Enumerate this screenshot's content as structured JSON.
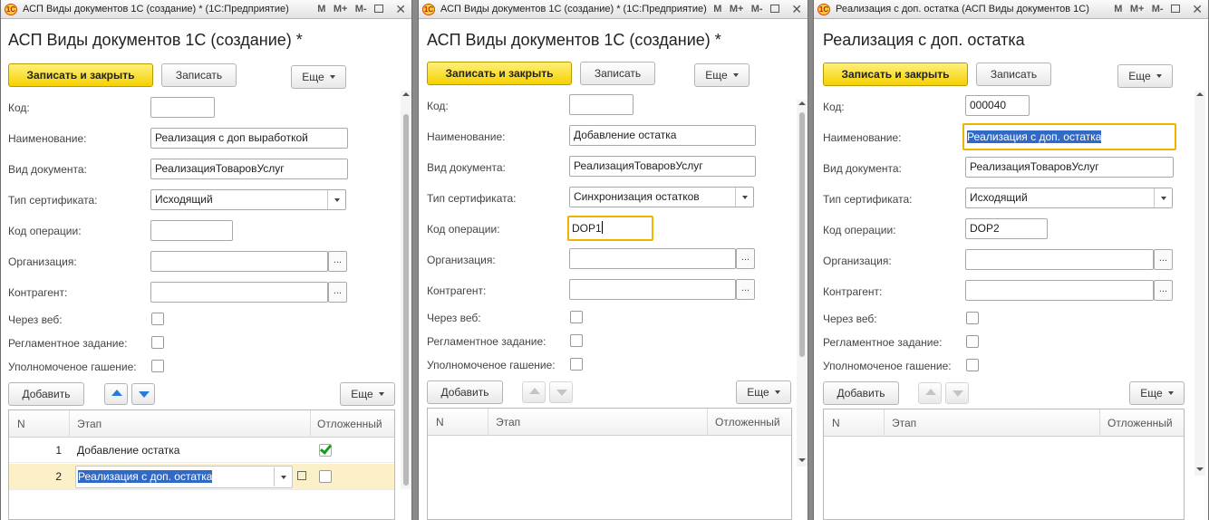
{
  "labels": {
    "code": "Код:",
    "name": "Наименование:",
    "doc_type": "Вид документа:",
    "cert_type": "Тип сертификата:",
    "op_code": "Код операции:",
    "org": "Организация:",
    "counterparty": "Контрагент:",
    "via_web": "Через веб:",
    "scheduled": "Регламентное задание:",
    "auth_payoff": "Уполномоченое гашение:"
  },
  "buttons": {
    "save_close": "Записать и закрыть",
    "save": "Записать",
    "more": "Еще",
    "add": "Добавить",
    "dots": "..."
  },
  "table_headers": {
    "n": "N",
    "stage": "Этап",
    "deferred": "Отложенный"
  },
  "titlebar_buttons": {
    "m": "M",
    "mplus": "M+",
    "mminus": "M-"
  },
  "logo": "1С",
  "windows": [
    {
      "window_title": "АСП Виды документов 1С (создание) * (1С:Предприятие)",
      "doc_title": "АСП Виды документов 1С (создание) *",
      "fields": {
        "code": "",
        "name": "Реализация с доп выработкой",
        "doc_type": "РеализацияТоваровУслуг",
        "cert_type": "Исходящий",
        "op_code": "",
        "org": "",
        "counterparty": ""
      },
      "rows": [
        {
          "n": "1",
          "stage": "Добавление остатка",
          "deferred": true
        },
        {
          "n": "2",
          "stage": "Реализация с доп. остатка",
          "deferred": false
        }
      ]
    },
    {
      "window_title": "АСП Виды документов 1С (создание) * (1С:Предприятие)",
      "doc_title": "АСП Виды документов 1С (создание) *",
      "fields": {
        "code": "",
        "name": "Добавление остатка",
        "doc_type": "РеализацияТоваровУслуг",
        "cert_type": "Синхронизация остатков",
        "op_code": "DOP1",
        "org": "",
        "counterparty": ""
      },
      "rows": []
    },
    {
      "window_title": "Реализация с доп. остатка (АСП Виды документов 1С)",
      "doc_title": "Реализация с доп. остатка",
      "fields": {
        "code": "000040",
        "name": "Реализация с доп. остатка",
        "doc_type": "РеализацияТоваровУслуг",
        "cert_type": "Исходящий",
        "op_code": "DOP2",
        "org": "",
        "counterparty": ""
      },
      "rows": []
    }
  ],
  "colors": {
    "primary_button": "#f5d100",
    "focus_border": "#f0b400",
    "selection": "#316ac5",
    "active_row": "#fbf0c8",
    "check": "#17a017",
    "move_arrows": "#2a7ad8"
  }
}
